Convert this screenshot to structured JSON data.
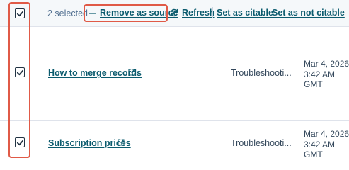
{
  "toolbar": {
    "selected_count_label": "2 selected",
    "remove_source_label": "Remove as source",
    "refresh_label": "Refresh",
    "set_citable_label": "Set as citable",
    "set_not_citable_label": "Set as not citable",
    "header_checkbox_checked": true
  },
  "rows": [
    {
      "checked": true,
      "name": "How to merge records",
      "category": "Troubleshooti...",
      "date_line1": "Mar 4, 2026",
      "date_line2": "3:42 AM",
      "date_line3": "GMT"
    },
    {
      "checked": true,
      "name": "Subscription prices",
      "category": "Troubleshooti...",
      "date_line1": "Mar 4, 2026",
      "date_line2": "3:42 AM",
      "date_line3": "GMT"
    }
  ],
  "icons": {
    "remove": "minus-icon",
    "refresh": "refresh-icon",
    "external": "external-link-icon",
    "checkbox": "checkmark-icon"
  },
  "colors": {
    "link": "#0b5b6e",
    "highlight": "#e05a47",
    "toolbar_bg": "#f5f8fa",
    "muted_text": "#516f90"
  }
}
